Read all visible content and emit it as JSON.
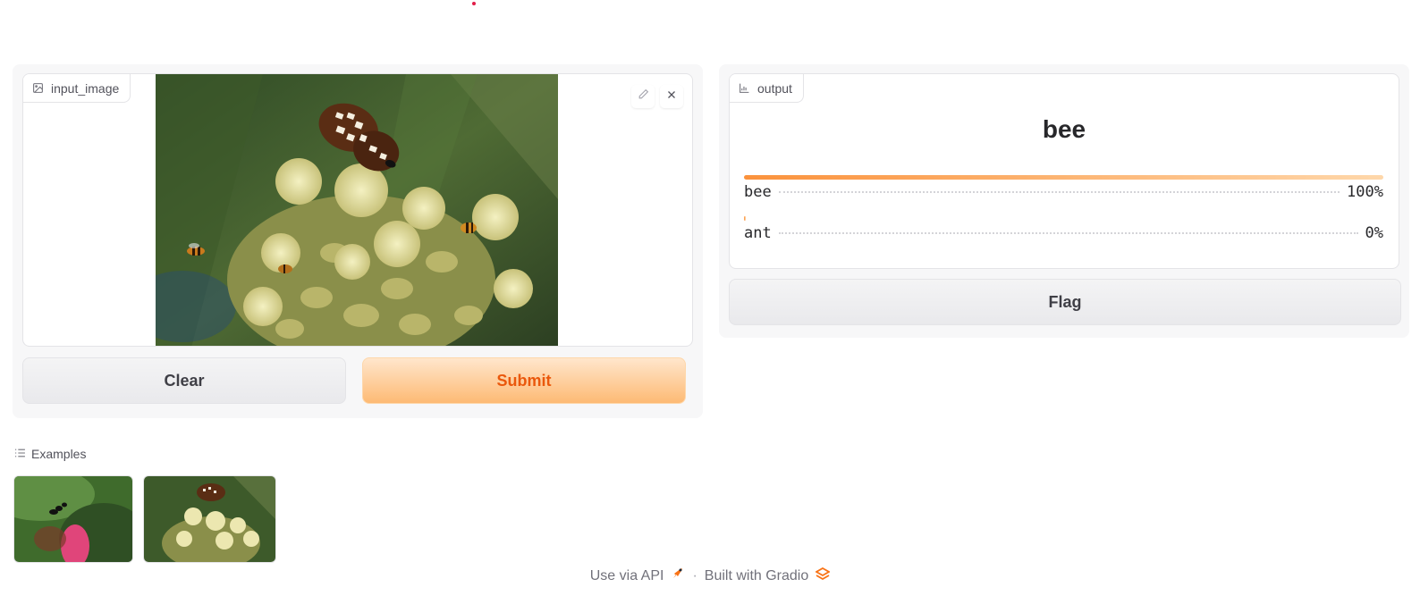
{
  "input": {
    "label": "input_image",
    "icons": {
      "label": "image-icon",
      "edit": "pencil-icon",
      "clear": "close-icon"
    }
  },
  "buttons": {
    "clear": "Clear",
    "submit": "Submit",
    "flag": "Flag"
  },
  "output": {
    "label": "output",
    "icon": "bar-chart-icon",
    "predicted": "bee",
    "confidences": [
      {
        "label": "bee",
        "value": "100%",
        "fraction": 1.0
      },
      {
        "label": "ant",
        "value": "0%",
        "fraction": 0.0
      }
    ]
  },
  "examples": {
    "title": "Examples",
    "icon": "list-icon",
    "items": [
      "ant-on-leaf-thumbnail",
      "butterfly-bees-flowers-thumbnail"
    ]
  },
  "footer": {
    "api": "Use via API",
    "api_icon": "rocket-icon",
    "separator": "·",
    "built": "Built with Gradio",
    "built_icon": "gradio-logo-icon"
  },
  "colors": {
    "accent": "#fb923c",
    "accent_text": "#ea580c",
    "panel_bg": "#f7f7f8",
    "border": "#e4e4e7"
  }
}
